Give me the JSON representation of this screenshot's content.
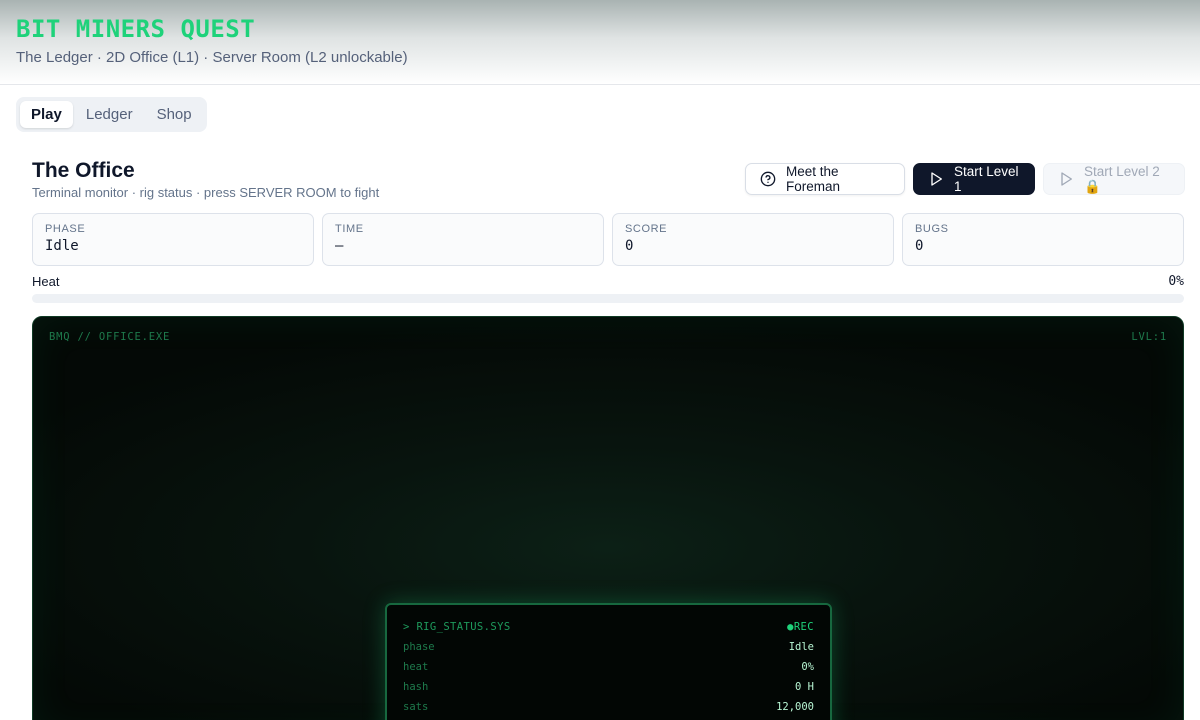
{
  "header": {
    "title": "BIT MINERS QUEST",
    "subtitle": "The Ledger · 2D Office (L1) · Server Room (L2 unlockable)"
  },
  "tabs": [
    {
      "label": "Play",
      "active": true
    },
    {
      "label": "Ledger",
      "active": false
    },
    {
      "label": "Shop",
      "active": false
    }
  ],
  "section": {
    "title": "The Office",
    "subtitle": "Terminal monitor · rig status · press SERVER ROOM to fight"
  },
  "buttons": {
    "foreman": "Meet the Foreman",
    "level1": "Start Level 1",
    "level2": "Start Level 2 🔒"
  },
  "stats": [
    {
      "label": "PHASE",
      "value": "Idle"
    },
    {
      "label": "TIME",
      "value": "—"
    },
    {
      "label": "SCORE",
      "value": "0"
    },
    {
      "label": "BUGS",
      "value": "0"
    }
  ],
  "heat": {
    "label": "Heat",
    "value_text": "0%",
    "percent": 0
  },
  "screen": {
    "top_left": "BMQ // OFFICE.EXE",
    "top_right": "LVL:1"
  },
  "rig_panel": {
    "title": "> RIG_STATUS.SYS",
    "rec": "●REC",
    "rows": [
      {
        "key": "phase",
        "value": "Idle"
      },
      {
        "key": "heat",
        "value": "0%"
      },
      {
        "key": "hash",
        "value": "0 H"
      },
      {
        "key": "sats",
        "value": "12,000"
      }
    ]
  },
  "colors": {
    "accent": "#1ed27a",
    "primary_button": "#0f172a"
  }
}
